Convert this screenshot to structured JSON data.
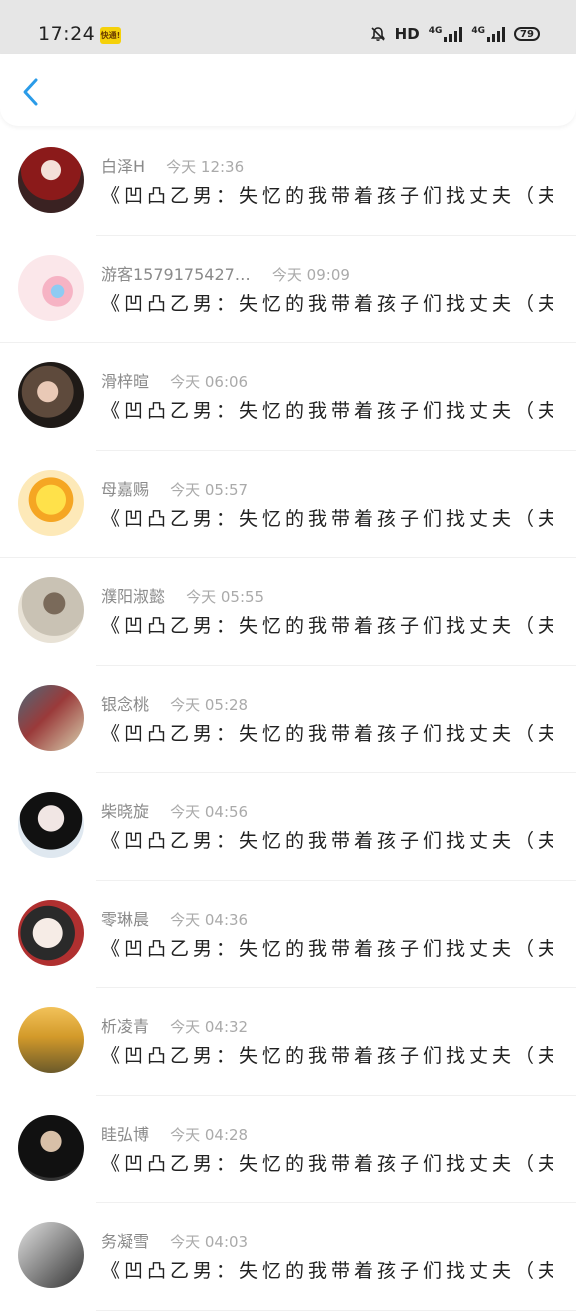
{
  "status": {
    "time": "17:24",
    "app_badge": "快通!",
    "hd": "HD",
    "net1": "4G",
    "net2": "4G",
    "battery": "79"
  },
  "header": {
    "back_icon": "chevron-left-icon"
  },
  "colors": {
    "accent": "#2a9be8",
    "name_text": "#8a8a8a",
    "time_text": "#aaaaaa",
    "message_text": "#222222"
  },
  "items": [
    {
      "name": "白泽H",
      "time": "今天 12:36",
      "message": "《凹凸乙男：失忆的我带着孩子们找丈夫（夫…"
    },
    {
      "name": "游客1579175427…",
      "time": "今天 09:09",
      "message": "《凹凸乙男：失忆的我带着孩子们找丈夫（夫…"
    },
    {
      "name": "滑梓暄",
      "time": "今天 06:06",
      "message": "《凹凸乙男：失忆的我带着孩子们找丈夫（夫…"
    },
    {
      "name": "母嘉赐",
      "time": "今天 05:57",
      "message": "《凹凸乙男：失忆的我带着孩子们找丈夫（夫…"
    },
    {
      "name": "濮阳淑懿",
      "time": "今天 05:55",
      "message": "《凹凸乙男：失忆的我带着孩子们找丈夫（夫…"
    },
    {
      "name": "银念桃",
      "time": "今天 05:28",
      "message": "《凹凸乙男：失忆的我带着孩子们找丈夫（夫…"
    },
    {
      "name": "柴晓旋",
      "time": "今天 04:56",
      "message": "《凹凸乙男：失忆的我带着孩子们找丈夫（夫…"
    },
    {
      "name": "零琳晨",
      "time": "今天 04:36",
      "message": "《凹凸乙男：失忆的我带着孩子们找丈夫（夫…"
    },
    {
      "name": "析凌青",
      "time": "今天 04:32",
      "message": "《凹凸乙男：失忆的我带着孩子们找丈夫（夫…"
    },
    {
      "name": "眭弘博",
      "time": "今天 04:28",
      "message": "《凹凸乙男：失忆的我带着孩子们找丈夫（夫…"
    },
    {
      "name": "务凝雪",
      "time": "今天 04:03",
      "message": "《凹凸乙男：失忆的我带着孩子们找丈夫（夫…"
    }
  ]
}
